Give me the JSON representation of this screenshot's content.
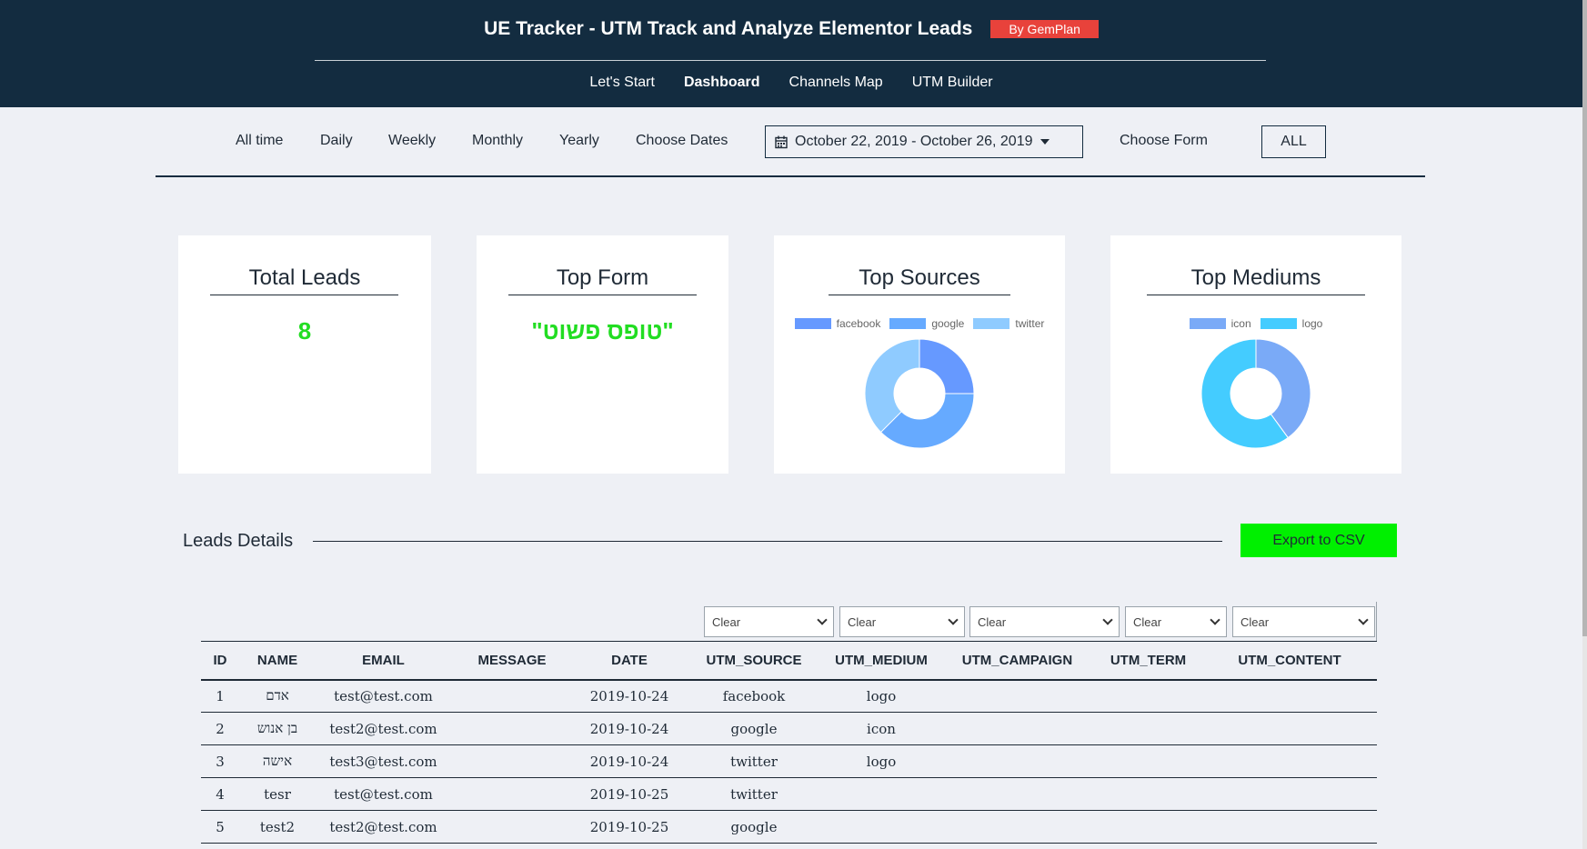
{
  "header": {
    "title": "UE Tracker - UTM Track and Analyze Elementor Leads",
    "badge": "By GemPlan",
    "nav": [
      {
        "label": "Let's Start"
      },
      {
        "label": "Dashboard"
      },
      {
        "label": "Channels Map"
      },
      {
        "label": "UTM Builder"
      }
    ]
  },
  "filters": {
    "periods": [
      "All time",
      "Daily",
      "Weekly",
      "Monthly",
      "Yearly",
      "Choose Dates"
    ],
    "date_range": "October 22, 2019 - October 26, 2019",
    "choose_form_label": "Choose Form",
    "form_value": "ALL"
  },
  "cards": {
    "total_leads": {
      "title": "Total Leads",
      "value": "8"
    },
    "top_form": {
      "title": "Top Form",
      "value": "\"טופס פשוט\""
    },
    "top_sources": {
      "title": "Top Sources",
      "chart_data": {
        "type": "pie",
        "labels": [
          "facebook",
          "google",
          "twitter"
        ],
        "values": [
          2,
          3,
          3
        ],
        "colors": [
          "#6699ff",
          "#66aaff",
          "#8fcbff"
        ]
      }
    },
    "top_mediums": {
      "title": "Top Mediums",
      "chart_data": {
        "type": "pie",
        "labels": [
          "icon",
          "logo"
        ],
        "values": [
          2,
          3
        ],
        "colors": [
          "#7aaaf7",
          "#44ccff"
        ]
      }
    }
  },
  "leads": {
    "section_title": "Leads Details",
    "export_label": "Export to CSV",
    "column_filters": [
      "Clear",
      "Clear",
      "Clear",
      "Clear",
      "Clear"
    ],
    "columns": [
      "ID",
      "NAME",
      "EMAIL",
      "MESSAGE",
      "DATE",
      "UTM_SOURCE",
      "UTM_MEDIUM",
      "UTM_CAMPAIGN",
      "UTM_TERM",
      "UTM_CONTENT"
    ],
    "rows": [
      [
        "1",
        "אדם",
        "test@test.com",
        "",
        "2019-10-24",
        "facebook",
        "logo",
        "",
        "",
        ""
      ],
      [
        "2",
        "בן אנוש",
        "test2@test.com",
        "",
        "2019-10-24",
        "google",
        "icon",
        "",
        "",
        ""
      ],
      [
        "3",
        "אישה",
        "test3@test.com",
        "",
        "2019-10-24",
        "twitter",
        "logo",
        "",
        "",
        ""
      ],
      [
        "4",
        "tesr",
        "test@test.com",
        "",
        "2019-10-25",
        "twitter",
        "",
        "",
        "",
        ""
      ],
      [
        "5",
        "test2",
        "test2@test.com",
        "",
        "2019-10-25",
        "google",
        "",
        "",
        "",
        ""
      ]
    ]
  }
}
